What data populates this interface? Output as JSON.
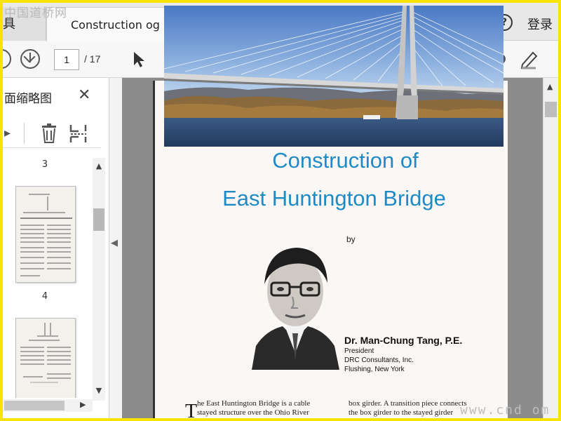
{
  "tabbar": {
    "tools_label": "具",
    "doc_tab_title": "Construction og E",
    "help_label": "?",
    "login_label": "登录"
  },
  "toolbar": {
    "current_page": "1",
    "total_pages": "/ 17"
  },
  "sidebar": {
    "title": "面缩略图",
    "close_label": "✕",
    "thumbnails": [
      {
        "label": "3"
      },
      {
        "label": "4"
      }
    ]
  },
  "document": {
    "title_line1": "Construction of",
    "title_line2": "East Huntington Bridge",
    "by": "by",
    "author_name": "Dr. Man-Chung Tang, P.E.",
    "author_lines": [
      "President",
      "DRC Consultants, Inc.",
      "Flushing, New York"
    ],
    "dropcap": "T",
    "col1_lines": [
      "he East Huntington Bridge is a cable",
      "stayed structure over the Ohio River"
    ],
    "col2_lines": [
      "box girder. A transition piece connects",
      "the box girder to the stayed girder"
    ]
  },
  "watermarks": {
    "top": "中国道桥网",
    "bottom": "www.cnd   om"
  },
  "colors": {
    "title_blue": "#1e8bc7",
    "frame_yellow": "#f5e500"
  }
}
